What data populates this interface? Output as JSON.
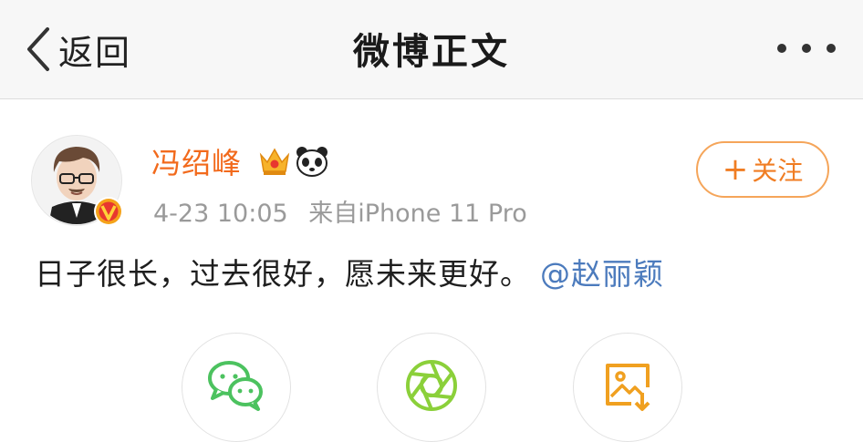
{
  "nav": {
    "back_label": "返回",
    "title": "微博正文"
  },
  "post": {
    "username": "冯绍峰",
    "timestamp": "4-23 10:05",
    "source": "来自iPhone 11 Pro",
    "follow_label": "关注",
    "text": "日子很长，过去很好，愿未来更好。",
    "mention": "@赵丽颖"
  },
  "icons": {
    "back": "chevron-left-icon",
    "more": "more-dots-icon",
    "crown": "crown-badge-icon",
    "panda": "panda-badge-icon",
    "verified": "verified-v-icon",
    "share_wechat": "wechat-icon",
    "share_moments": "moments-icon",
    "share_save_image": "save-image-icon"
  },
  "colors": {
    "username": "#f26a1c",
    "follow": "#f07d23",
    "mention": "#4c7bbd",
    "wechat": "#4cc25f",
    "moments": "#8bd03a",
    "save_image": "#f0a020"
  }
}
